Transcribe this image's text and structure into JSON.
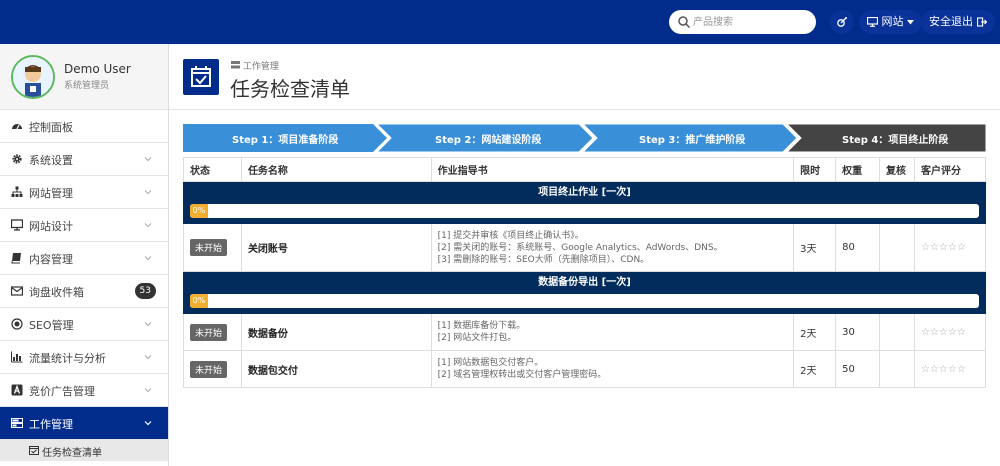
{
  "topbar": {
    "search_placeholder": "产品搜索",
    "site_label": "网站",
    "logout_label": "安全退出"
  },
  "sidebar": {
    "user_name": "Demo User",
    "user_role": "系统管理员",
    "items": [
      {
        "label": "控制面板",
        "icon": "dashboard-icon"
      },
      {
        "label": "系统设置",
        "icon": "gear-icon"
      },
      {
        "label": "网站管理",
        "icon": "sitemap-icon"
      },
      {
        "label": "网站设计",
        "icon": "monitor-icon"
      },
      {
        "label": "内容管理",
        "icon": "book-icon"
      },
      {
        "label": "询盘收件箱",
        "icon": "envelope-icon",
        "badge": "53"
      },
      {
        "label": "SEO管理",
        "icon": "target-icon"
      },
      {
        "label": "流量统计与分析",
        "icon": "bar-chart-icon"
      },
      {
        "label": "竞价广告管理",
        "icon": "ad-icon"
      },
      {
        "label": "工作管理",
        "icon": "tasks-icon"
      }
    ],
    "sub_item": "任务检查清单"
  },
  "page": {
    "breadcrumb": "工作管理",
    "title": "任务检查清单"
  },
  "steps": [
    {
      "label": "Step 1：项目准备阶段"
    },
    {
      "label": "Step 2：网站建设阶段"
    },
    {
      "label": "Step 3：推广维护阶段"
    },
    {
      "label": "Step 4：项目终止阶段"
    }
  ],
  "table": {
    "headers": [
      "状态",
      "任务名称",
      "作业指导书",
      "限时",
      "权重",
      "复核",
      "客户评分"
    ],
    "sections": [
      {
        "title": "项目终止作业 [一次]",
        "progress": "0%",
        "tasks": [
          {
            "status": "未开始",
            "name": "关闭账号",
            "guide": [
              "[1] 提交并审核《项目终止确认书》。",
              "[2] 需关闭的账号：系统账号、Google Analytics、AdWords、DNS。",
              "[3] 需删除的账号：SEO大师（先删除项目）、CDN。"
            ],
            "time": "3天",
            "weight": "80",
            "review": "",
            "rating": "☆☆☆☆☆"
          }
        ]
      },
      {
        "title": "数据备份导出 [一次]",
        "progress": "0%",
        "tasks": [
          {
            "status": "未开始",
            "name": "数据备份",
            "guide": [
              "[1] 数据库备份下载。",
              "[2] 网站文件打包。"
            ],
            "time": "2天",
            "weight": "30",
            "review": "",
            "rating": "☆☆☆☆☆"
          },
          {
            "status": "未开始",
            "name": "数据包交付",
            "guide": [
              "[1] 网站数据包交付客户。",
              "[2] 域名管理权转出或交付客户管理密码。"
            ],
            "time": "2天",
            "weight": "50",
            "review": "",
            "rating": "☆☆☆☆☆"
          }
        ]
      }
    ]
  },
  "colors": {
    "brand": "#022c8c",
    "step_done": "#3a8fd9",
    "step_current": "#444444",
    "section_bg": "#022c5c",
    "progress": "#f0ad2e"
  }
}
